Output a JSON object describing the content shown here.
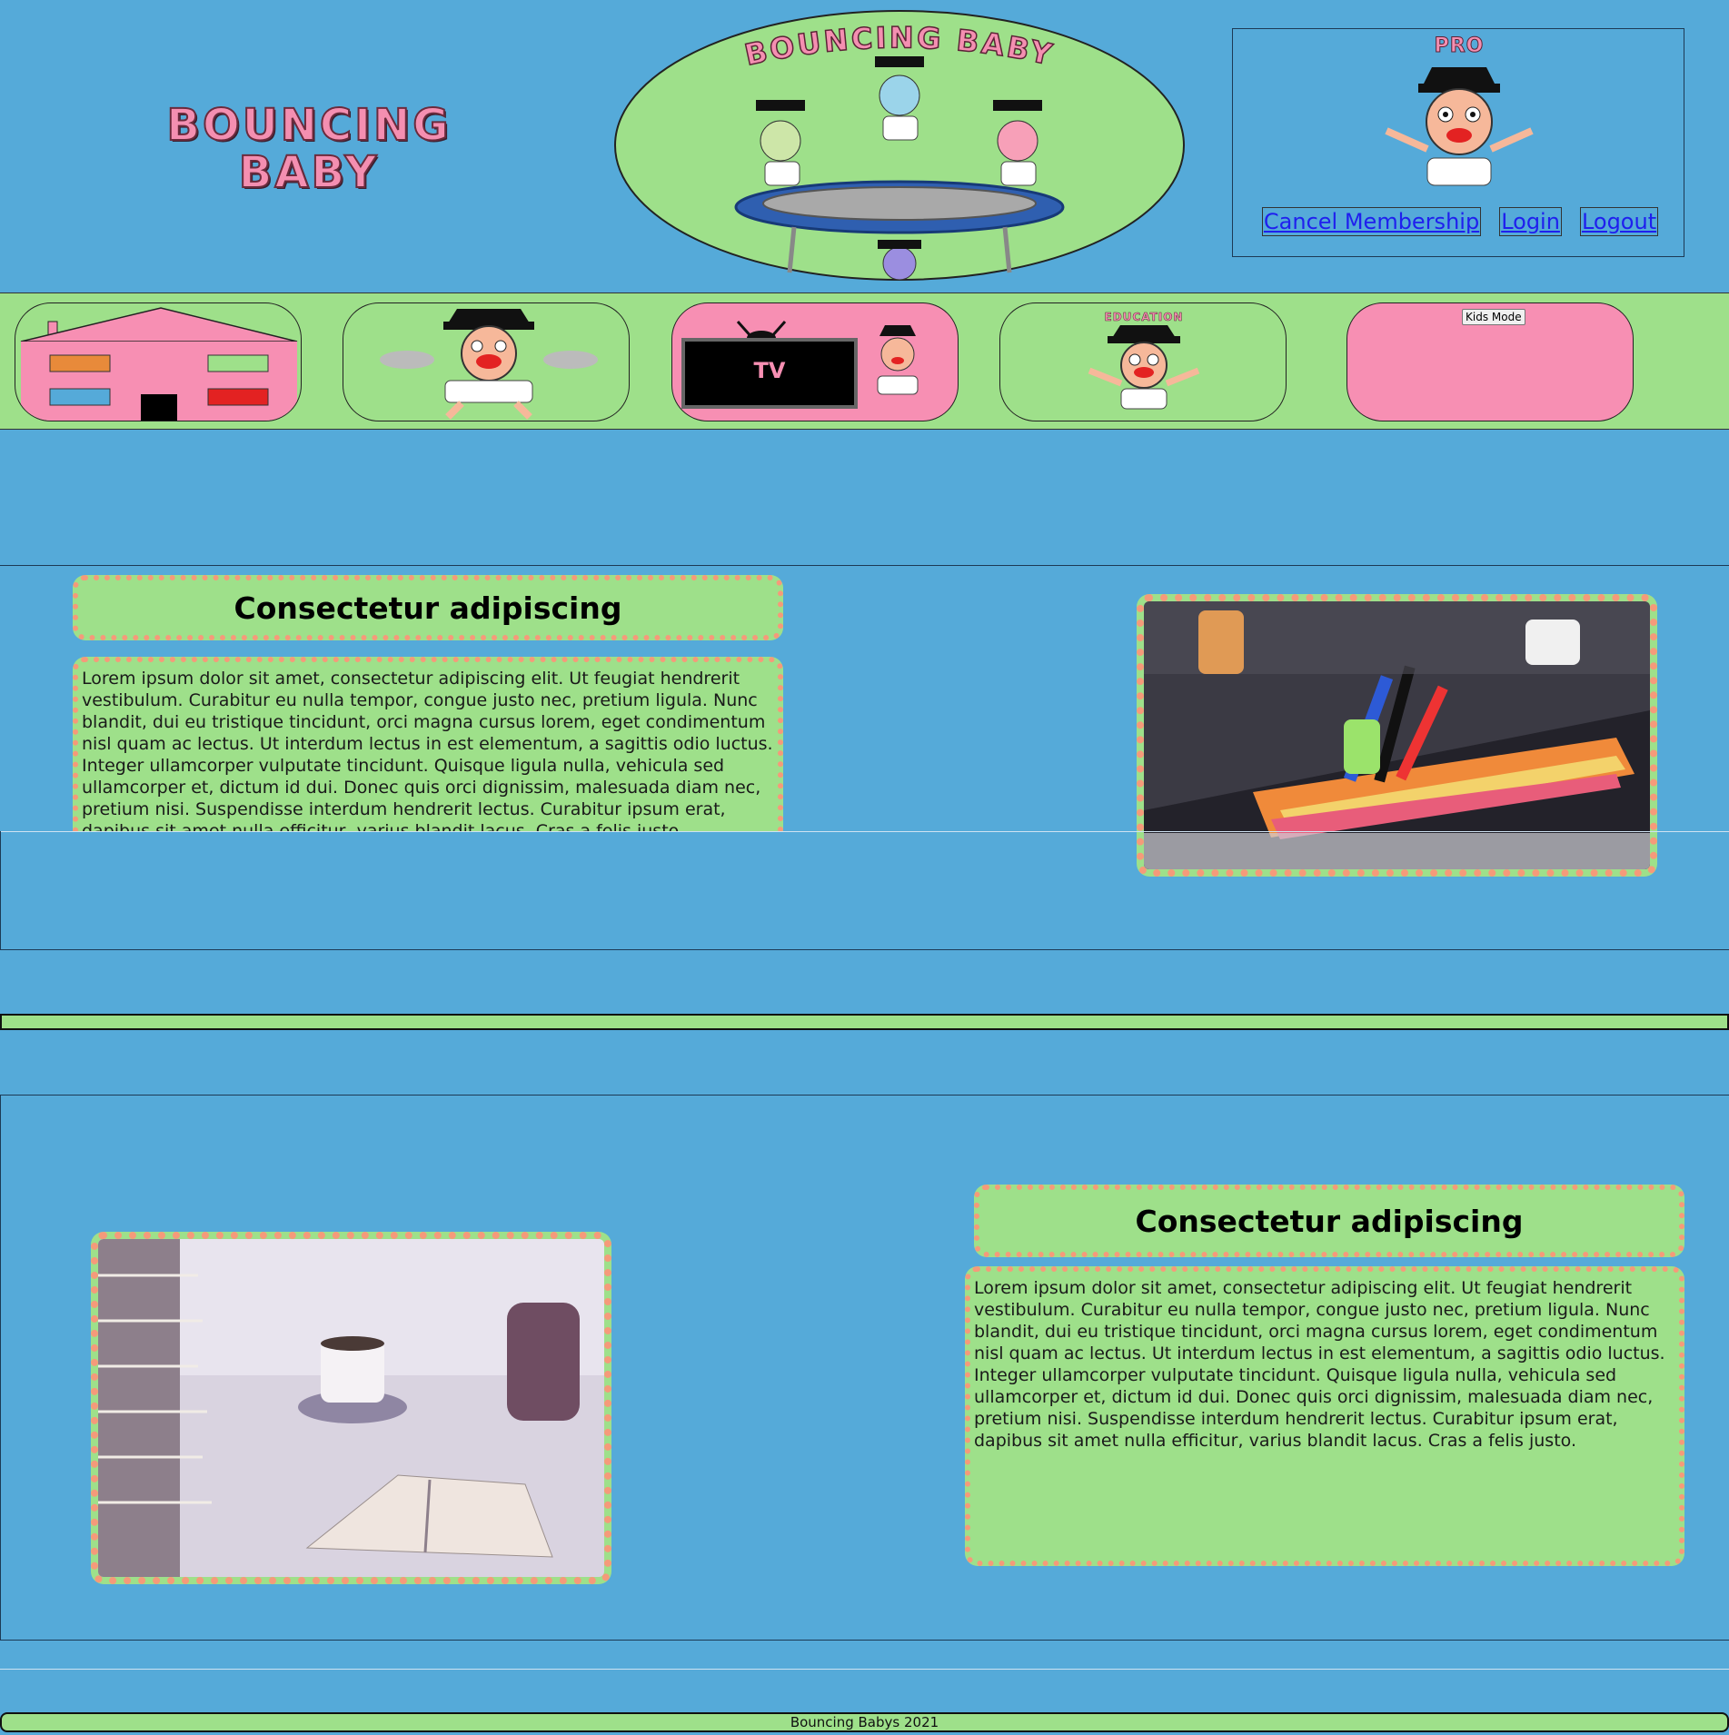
{
  "header": {
    "logo_line1": "BOUNCING",
    "logo_line2": "BABY",
    "banner_title": "BOUNCING BABY",
    "pro_label": "PRO",
    "links": {
      "cancel": "Cancel Membership",
      "login": "Login",
      "logout": "Logout"
    }
  },
  "nav": {
    "tv_label": "TV",
    "education_label": "EDUCATION",
    "kids_mode": "Kids Mode"
  },
  "section1": {
    "heading": "Consectetur adipiscing",
    "body": "Lorem ipsum dolor sit amet, consectetur adipiscing elit. Ut feugiat hendrerit vestibulum. Curabitur eu nulla tempor, congue justo nec, pretium ligula. Nunc blandit, dui eu tristique tincidunt, orci magna cursus lorem, eget condimentum nisl quam ac lectus. Ut interdum lectus in est elementum, a sagittis odio luctus. Integer ullamcorper vulputate tincidunt. Quisque ligula nulla, vehicula sed ullamcorper et, dictum id dui. Donec quis orci dignissim, malesuada diam nec, pretium nisi. Suspendisse interdum hendrerit lectus. Curabitur ipsum erat, dapibus sit amet nulla efficitur, varius blandit lacus. Cras a felis justo."
  },
  "section2": {
    "heading": "Consectetur adipiscing",
    "body": "Lorem ipsum dolor sit amet, consectetur adipiscing elit. Ut feugiat hendrerit vestibulum. Curabitur eu nulla tempor, congue justo nec, pretium ligula. Nunc blandit, dui eu tristique tincidunt, orci magna cursus lorem, eget condimentum nisl quam ac lectus. Ut interdum lectus in est elementum, a sagittis odio luctus. Integer ullamcorper vulputate tincidunt. Quisque ligula nulla, vehicula sed ullamcorper et, dictum id dui. Donec quis orci dignissim, malesuada diam nec, pretium nisi. Suspendisse interdum hendrerit lectus. Curabitur ipsum erat, dapibus sit amet nulla efficitur, varius blandit lacus. Cras a felis justo."
  },
  "footer": {
    "text": "Bouncing Babys 2021"
  },
  "colors": {
    "page_bg": "#55aad9",
    "green": "#9ee08a",
    "pink": "#f78fb3",
    "dots": "#f59a7a"
  }
}
